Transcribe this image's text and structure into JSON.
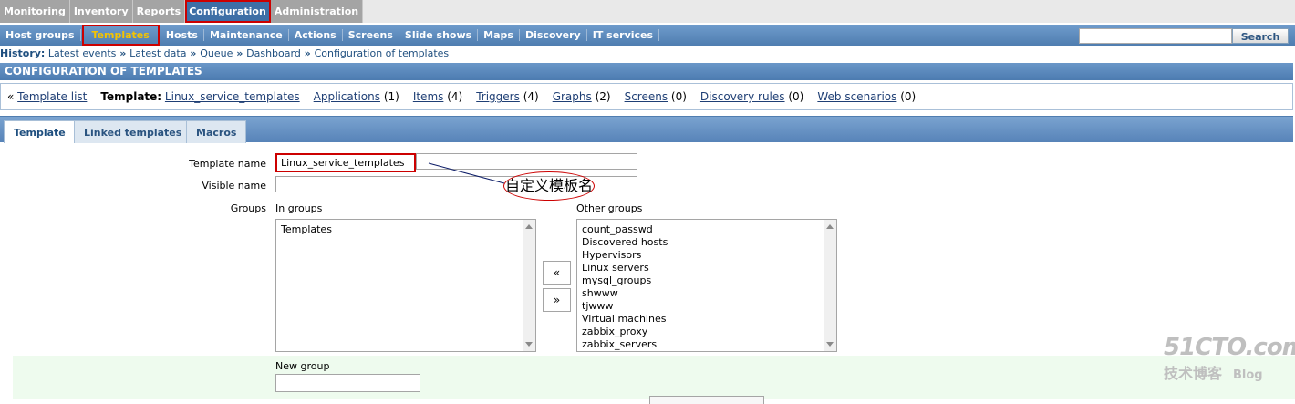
{
  "top_menu": {
    "items": [
      "Monitoring",
      "Inventory",
      "Reports",
      "Configuration",
      "Administration"
    ],
    "active": "Configuration"
  },
  "sub_menu": {
    "items": [
      "Host groups",
      "Templates",
      "Hosts",
      "Maintenance",
      "Actions",
      "Screens",
      "Slide shows",
      "Maps",
      "Discovery",
      "IT services"
    ],
    "selected": "Templates",
    "search_value": "",
    "search_button": "Search"
  },
  "history": {
    "label": "History:",
    "items": [
      "Latest events",
      "Latest data",
      "Queue",
      "Dashboard",
      "Configuration of templates"
    ]
  },
  "page_title": "CONFIGURATION OF TEMPLATES",
  "nav": {
    "back_prefix": "«",
    "template_list": "Template list",
    "template_label": "Template:",
    "template_name": "Linux_service_templates",
    "applications": "Applications",
    "applications_count": "(1)",
    "items": "Items",
    "items_count": "(4)",
    "triggers": "Triggers",
    "triggers_count": "(4)",
    "graphs": "Graphs",
    "graphs_count": "(2)",
    "screens": "Screens",
    "screens_count": "(0)",
    "discovery_rules": "Discovery rules",
    "discovery_rules_count": "(0)",
    "web_scenarios": "Web scenarios",
    "web_scenarios_count": "(0)"
  },
  "form_tabs": [
    "Template",
    "Linked templates",
    "Macros"
  ],
  "form": {
    "template_name_label": "Template name",
    "template_name_value": "Linux_service_templates",
    "visible_name_label": "Visible name",
    "visible_name_value": "",
    "groups_label": "Groups",
    "in_groups_label": "In groups",
    "other_groups_label": "Other groups",
    "in_groups": [
      "Templates"
    ],
    "other_groups": [
      "count_passwd",
      "Discovered hosts",
      "Hypervisors",
      "Linux servers",
      "mysql_groups",
      "shwww",
      "tjwww",
      "Virtual machines",
      "zabbix_proxy",
      "zabbix_servers"
    ],
    "move_left": "«",
    "move_right": "»",
    "new_group_label": "New group",
    "new_group_value": ""
  },
  "annotation": "自定义模板名",
  "watermark": {
    "logo": "51CTO.com",
    "tagline": "技术博客",
    "blog": "Blog"
  }
}
